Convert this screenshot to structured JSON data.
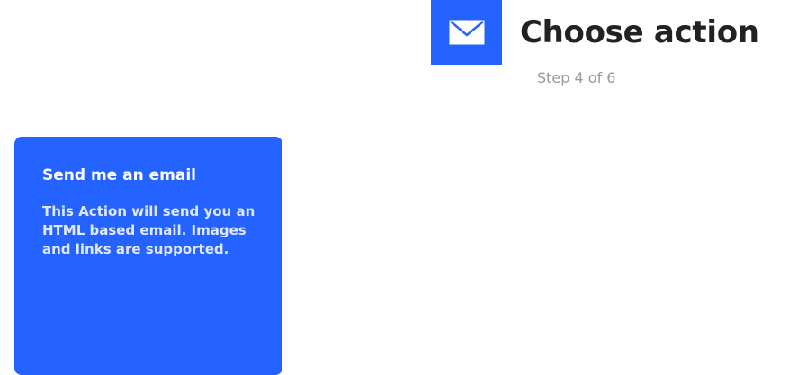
{
  "header": {
    "service_icon": "envelope-icon",
    "title": "Choose action",
    "step": "Step 4 of 6"
  },
  "actions": [
    {
      "title": "Send me an email",
      "description": "This Action will send you an HTML based email. Images and links are supported."
    }
  ],
  "colors": {
    "accent": "#2463ff",
    "title_text": "#222222",
    "step_text": "#999999",
    "card_text": "#ffffff"
  }
}
